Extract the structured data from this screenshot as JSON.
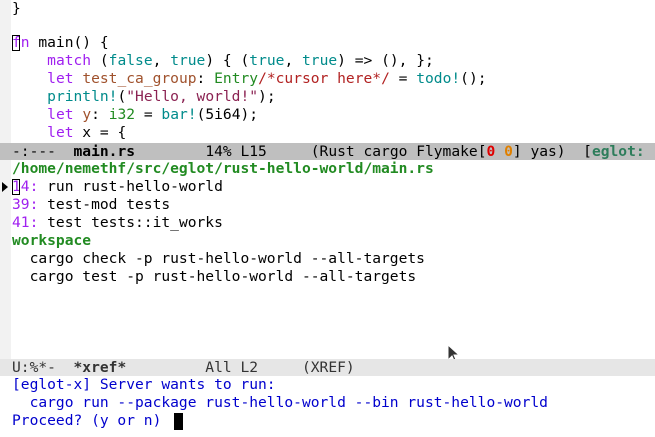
{
  "code": {
    "l0": "}",
    "l1_fn": "fn",
    "l1_rest": " main() {",
    "l2_match": "match",
    "l2_a": " (",
    "l2_false": "false",
    "l2_b": ", ",
    "l2_true": "true",
    "l2_c": ") { (",
    "l2_true2": "true",
    "l2_d": ", ",
    "l2_true3": "true",
    "l2_e": ") => (), };",
    "l3_let": "let",
    "l3_sp": " ",
    "l3_var": "test_ca_group",
    "l3_colon": ": ",
    "l3_type": "Entry",
    "l3_cmt": "/*cursor here*/",
    "l3_eq": " = ",
    "l3_todo": "todo!",
    "l3_end": "();",
    "l4_println": "println!",
    "l4_a": "(",
    "l4_str": "\"Hello, world!\"",
    "l4_end": ");",
    "l5_let": "let",
    "l5_sp": " ",
    "l5_var": "y",
    "l5_colon": ": ",
    "l5_type": "i32",
    "l5_eq": " = ",
    "l5_bar": "bar!",
    "l5_end": "(5i64);",
    "l6_let": "let",
    "l6_rest": " x = {"
  },
  "modeline1": {
    "status": "-:---  ",
    "buffer": "main.rs",
    "pos": "        14% L15     (Rust cargo Flymake[",
    "err": "0",
    "sp": " ",
    "warn": "0",
    "tail": "] yas)  [",
    "eglot": "eglot:"
  },
  "xref": {
    "path": "/home/nemethf/src/eglot/rust-hello-world/main.rs",
    "items": [
      {
        "num": "14:",
        "text": " run rust-hello-world"
      },
      {
        "num": "39:",
        "text": " test-mod tests"
      },
      {
        "num": "41:",
        "text": " test tests::it_works"
      }
    ],
    "workspace_header": "workspace",
    "workspace_items": [
      "  cargo check -p rust-hello-world --all-targets",
      "  cargo test -p rust-hello-world --all-targets"
    ]
  },
  "modeline2": {
    "status": "U:%*-  ",
    "buffer": "*xref*",
    "pos": "         All L2     (XREF)"
  },
  "minibuffer": {
    "line1": "[eglot-x] Server wants to run:",
    "line2": "  cargo run --package rust-hello-world --bin rust-hello-world",
    "line3": "Proceed? (y or n) "
  }
}
